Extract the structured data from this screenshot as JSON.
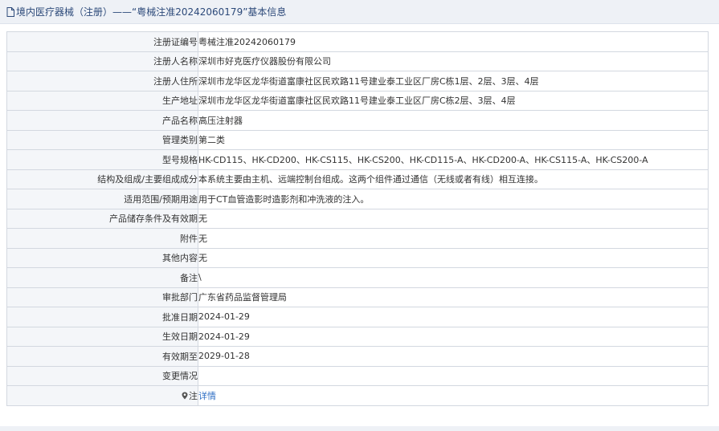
{
  "header": {
    "icon": "document-icon",
    "title": "境内医疗器械（注册）——“粤械注准20242060179”基本信息"
  },
  "rows": [
    {
      "label": "注册证编号",
      "value": "粤械注准20242060179"
    },
    {
      "label": "注册人名称",
      "value": "深圳市好克医疗仪器股份有限公司"
    },
    {
      "label": "注册人住所",
      "value": "深圳市龙华区龙华街道富康社区民欢路11号建业泰工业区厂房C栋1层、2层、3层、4层"
    },
    {
      "label": "生产地址",
      "value": "深圳市龙华区龙华街道富康社区民欢路11号建业泰工业区厂房C栋2层、3层、4层"
    },
    {
      "label": "产品名称",
      "value": "高压注射器"
    },
    {
      "label": "管理类别",
      "value": "第二类"
    },
    {
      "label": "型号规格",
      "value": "HK-CD115、HK-CD200、HK-CS115、HK-CS200、HK-CD115-A、HK-CD200-A、HK-CS115-A、HK-CS200-A"
    },
    {
      "label": "结构及组成/主要组成成分",
      "value": "本系统主要由主机、远端控制台组成。这两个组件通过通信（无线或者有线）相互连接。"
    },
    {
      "label": "适用范围/预期用途",
      "value": "用于CT血管造影时造影剂和冲洗液的注入。"
    },
    {
      "label": "产品储存条件及有效期",
      "value": "无"
    },
    {
      "label": "附件",
      "value": "无"
    },
    {
      "label": "其他内容",
      "value": "无"
    },
    {
      "label": "备注",
      "value": "\\"
    },
    {
      "label": "审批部门",
      "value": "广东省药品监督管理局"
    },
    {
      "label": "批准日期",
      "value": "2024-01-29"
    },
    {
      "label": "生效日期",
      "value": "2024-01-29"
    },
    {
      "label": "有效期至",
      "value": "2029-01-28"
    },
    {
      "label": "变更情况",
      "value": ""
    },
    {
      "label": "注",
      "value": "详情",
      "icon": "pin-icon"
    }
  ],
  "colors": {
    "header_bg": "#eef1f6",
    "label_bg": "#f4f6f9",
    "border": "#d3d8e0",
    "link": "#2f6fc4"
  }
}
